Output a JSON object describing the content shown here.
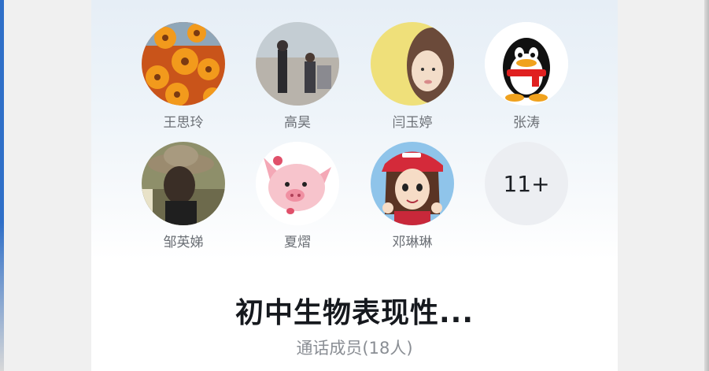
{
  "members": [
    {
      "name": "王思玲",
      "avatar": "sunflowers-photo-icon"
    },
    {
      "name": "高昊",
      "avatar": "street-photo-icon"
    },
    {
      "name": "闫玉婷",
      "avatar": "girl-photo-icon"
    },
    {
      "name": "张涛",
      "avatar": "qq-penguin-icon"
    },
    {
      "name": "邹英娣",
      "avatar": "hat-photo-icon"
    },
    {
      "name": "夏熠",
      "avatar": "pig-cartoon-icon"
    },
    {
      "name": "邓琳琳",
      "avatar": "cartoon-girl-icon"
    }
  ],
  "more_count": "11+",
  "group": {
    "title": "初中生物表现性...",
    "subtitle": "通话成员(18人)"
  },
  "colors": {
    "panel_top": "#e6eef6",
    "text_dark": "#16191e",
    "text_muted": "#8a8e94",
    "more_bg": "#eceef2"
  }
}
